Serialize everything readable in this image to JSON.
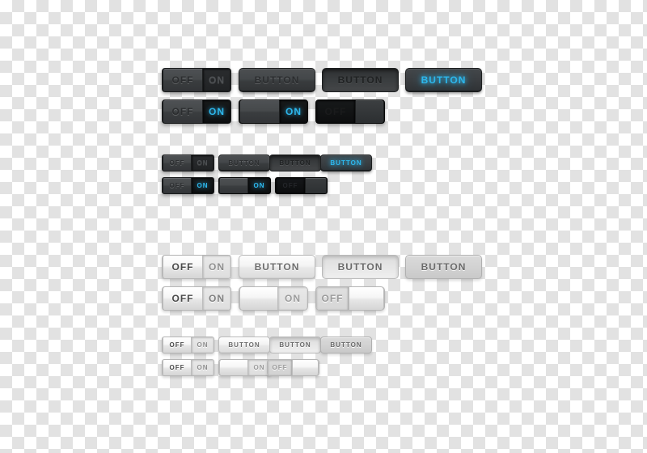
{
  "labels": {
    "off": "OFF",
    "on": "ON",
    "button": "BUTTON",
    "blank": ""
  },
  "colors": {
    "cyan_accent": "#2DB7EC",
    "dark_face": "#44474A",
    "dark_track": "#26282A",
    "dark_deep": "#131415",
    "light_face": "#F1F1F1",
    "light_track": "#E3E3E3",
    "light_flat": "#D2D2D2",
    "checker_light": "#FFFFFF",
    "checker_gray": "#E2E2E2"
  },
  "groups": [
    {
      "name": "dark-large",
      "theme": "dark",
      "size": "large",
      "rows": [
        {
          "name": "dark-large-row-1",
          "widgets": [
            {
              "kind": "toggle",
              "name": "toggle-off-dark-large",
              "state": "off",
              "left_label": "OFF",
              "right_label": "ON",
              "knob": "left",
              "knob_label": "OFF",
              "track_label": "ON",
              "track_style": "normal"
            },
            {
              "kind": "button",
              "name": "button-dark-large-normal",
              "label": "BUTTON",
              "style": "normal"
            },
            {
              "kind": "button",
              "name": "button-dark-large-pressed",
              "label": "BUTTON",
              "style": "pressed"
            },
            {
              "kind": "button",
              "name": "button-dark-large-glow",
              "label": "BUTTON",
              "style": "glow"
            }
          ]
        },
        {
          "name": "dark-large-row-2",
          "widgets": [
            {
              "kind": "toggle",
              "name": "toggle-on-dark-large-cyan",
              "state": "on",
              "knob": "left",
              "knob_label": "OFF",
              "track_label": "ON",
              "track_style": "cyan"
            },
            {
              "kind": "toggle",
              "name": "toggle-on-dark-large-knobleft-blank",
              "state": "on",
              "knob": "left",
              "knob_label": "",
              "track_label": "ON",
              "track_style": "cyan"
            },
            {
              "kind": "toggle",
              "name": "toggle-off-dark-large-deep",
              "state": "off",
              "knob": "right",
              "knob_label": "",
              "track_label": "OFF",
              "track_style": "deep"
            }
          ]
        }
      ]
    },
    {
      "name": "dark-small",
      "theme": "dark",
      "size": "small",
      "rows": [
        {
          "name": "dark-small-row-1",
          "widgets": [
            {
              "kind": "toggle",
              "name": "toggle-off-dark-small",
              "state": "off",
              "knob": "left",
              "knob_label": "OFF",
              "track_label": "ON",
              "track_style": "normal"
            },
            {
              "kind": "button",
              "name": "button-dark-small-normal",
              "label": "BUTTON",
              "style": "normal"
            },
            {
              "kind": "button",
              "name": "button-dark-small-pressed",
              "label": "BUTTON",
              "style": "pressed"
            },
            {
              "kind": "button",
              "name": "button-dark-small-glow",
              "label": "BUTTON",
              "style": "glow"
            }
          ]
        },
        {
          "name": "dark-small-row-2",
          "widgets": [
            {
              "kind": "toggle",
              "name": "toggle-on-dark-small-cyan",
              "state": "on",
              "knob": "left",
              "knob_label": "OFF",
              "track_label": "ON",
              "track_style": "cyan"
            },
            {
              "kind": "toggle",
              "name": "toggle-on-dark-small-blank",
              "state": "on",
              "knob": "left",
              "knob_label": "",
              "track_label": "ON",
              "track_style": "cyan"
            },
            {
              "kind": "toggle",
              "name": "toggle-off-dark-small-deep",
              "state": "off",
              "knob": "right",
              "knob_label": "",
              "track_label": "OFF",
              "track_style": "deep"
            }
          ]
        }
      ]
    },
    {
      "name": "light-large",
      "theme": "light",
      "size": "large",
      "rows": [
        {
          "name": "light-large-row-1",
          "widgets": [
            {
              "kind": "toggle",
              "name": "toggle-off-light-large",
              "state": "off",
              "knob": "left",
              "knob_label": "OFF",
              "track_label": "ON",
              "track_style": "normal"
            },
            {
              "kind": "button",
              "name": "button-light-large-normal",
              "label": "BUTTON",
              "style": "normal"
            },
            {
              "kind": "button",
              "name": "button-light-large-pressed",
              "label": "BUTTON",
              "style": "pressed"
            },
            {
              "kind": "button",
              "name": "button-light-large-flat",
              "label": "BUTTON",
              "style": "flat"
            }
          ]
        },
        {
          "name": "light-large-row-2",
          "widgets": [
            {
              "kind": "toggle",
              "name": "toggle-off-light-large-dup",
              "state": "off",
              "knob": "left",
              "knob_label": "OFF",
              "track_label": "ON",
              "track_style": "normal"
            },
            {
              "kind": "toggle",
              "name": "toggle-on-light-large-blank",
              "state": "on",
              "knob": "left",
              "knob_label": "",
              "track_label": "ON",
              "track_style": "gray"
            },
            {
              "kind": "toggle",
              "name": "toggle-off-light-large-right",
              "state": "off",
              "knob": "right",
              "knob_label": "",
              "track_label": "OFF",
              "track_style": "gray"
            }
          ]
        }
      ]
    },
    {
      "name": "light-small",
      "theme": "light",
      "size": "small",
      "rows": [
        {
          "name": "light-small-row-1",
          "widgets": [
            {
              "kind": "toggle",
              "name": "toggle-off-light-small",
              "state": "off",
              "knob": "left",
              "knob_label": "OFF",
              "track_label": "ON",
              "track_style": "normal"
            },
            {
              "kind": "button",
              "name": "button-light-small-normal",
              "label": "BUTTON",
              "style": "normal"
            },
            {
              "kind": "button",
              "name": "button-light-small-pressed",
              "label": "BUTTON",
              "style": "pressed"
            },
            {
              "kind": "button",
              "name": "button-light-small-flat",
              "label": "BUTTON",
              "style": "flat"
            }
          ]
        },
        {
          "name": "light-small-row-2",
          "widgets": [
            {
              "kind": "toggle",
              "name": "toggle-off-light-small-dup",
              "state": "off",
              "knob": "left",
              "knob_label": "OFF",
              "track_label": "ON",
              "track_style": "normal"
            },
            {
              "kind": "toggle",
              "name": "toggle-on-light-small-blank",
              "state": "on",
              "knob": "left",
              "knob_label": "",
              "track_label": "ON",
              "track_style": "gray"
            },
            {
              "kind": "toggle",
              "name": "toggle-off-light-small-right",
              "state": "off",
              "knob": "right",
              "knob_label": "",
              "track_label": "OFF",
              "track_style": "gray"
            }
          ]
        }
      ]
    }
  ]
}
